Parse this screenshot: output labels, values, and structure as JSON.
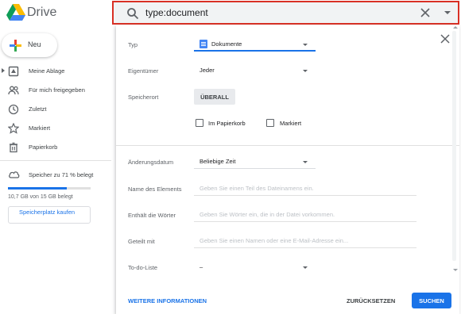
{
  "app": {
    "name": "Drive"
  },
  "search": {
    "query": "type:document"
  },
  "sidebar": {
    "new_label": "Neu",
    "items": [
      {
        "label": "Meine Ablage",
        "icon": "my-drive-icon"
      },
      {
        "label": "Für mich freigegeben",
        "icon": "shared-with-me-icon"
      },
      {
        "label": "Zuletzt",
        "icon": "clock-icon"
      },
      {
        "label": "Markiert",
        "icon": "star-icon"
      },
      {
        "label": "Papierkorb",
        "icon": "trash-icon"
      }
    ],
    "storage": {
      "label": "Speicher zu 71 % belegt",
      "used_text": "10,7 GB von 15 GB belegt",
      "used_fraction": 0.71,
      "buy_label": "Speicherplatz kaufen"
    }
  },
  "panel": {
    "type": {
      "label": "Typ",
      "value": "Dokumente"
    },
    "owner": {
      "label": "Eigentümer",
      "value": "Jeder"
    },
    "location": {
      "label": "Speicherort",
      "chip": "ÜBERALL"
    },
    "checkboxes": {
      "trash": "Im Papierkorb",
      "starred": "Markiert"
    },
    "modified": {
      "label": "Änderungsdatum",
      "value": "Beliebige Zeit"
    },
    "item_name": {
      "label": "Name des Elements",
      "placeholder": "Geben Sie einen Teil des Dateinamens ein."
    },
    "has_words": {
      "label": "Enthält die Wörter",
      "placeholder": "Geben Sie Wörter ein, die in der Datei vorkommen."
    },
    "shared_with": {
      "label": "Geteilt mit",
      "placeholder": "Geben Sie einen Namen oder eine E-Mail-Adresse ein..."
    },
    "todo": {
      "label": "To-do-Liste",
      "value": "–"
    },
    "more_info": "WEITERE INFORMATIONEN",
    "reset": "ZURÜCKSETZEN",
    "search": "SUCHEN"
  },
  "colors": {
    "accent": "#1a73e8",
    "search_border": "#d93025"
  }
}
